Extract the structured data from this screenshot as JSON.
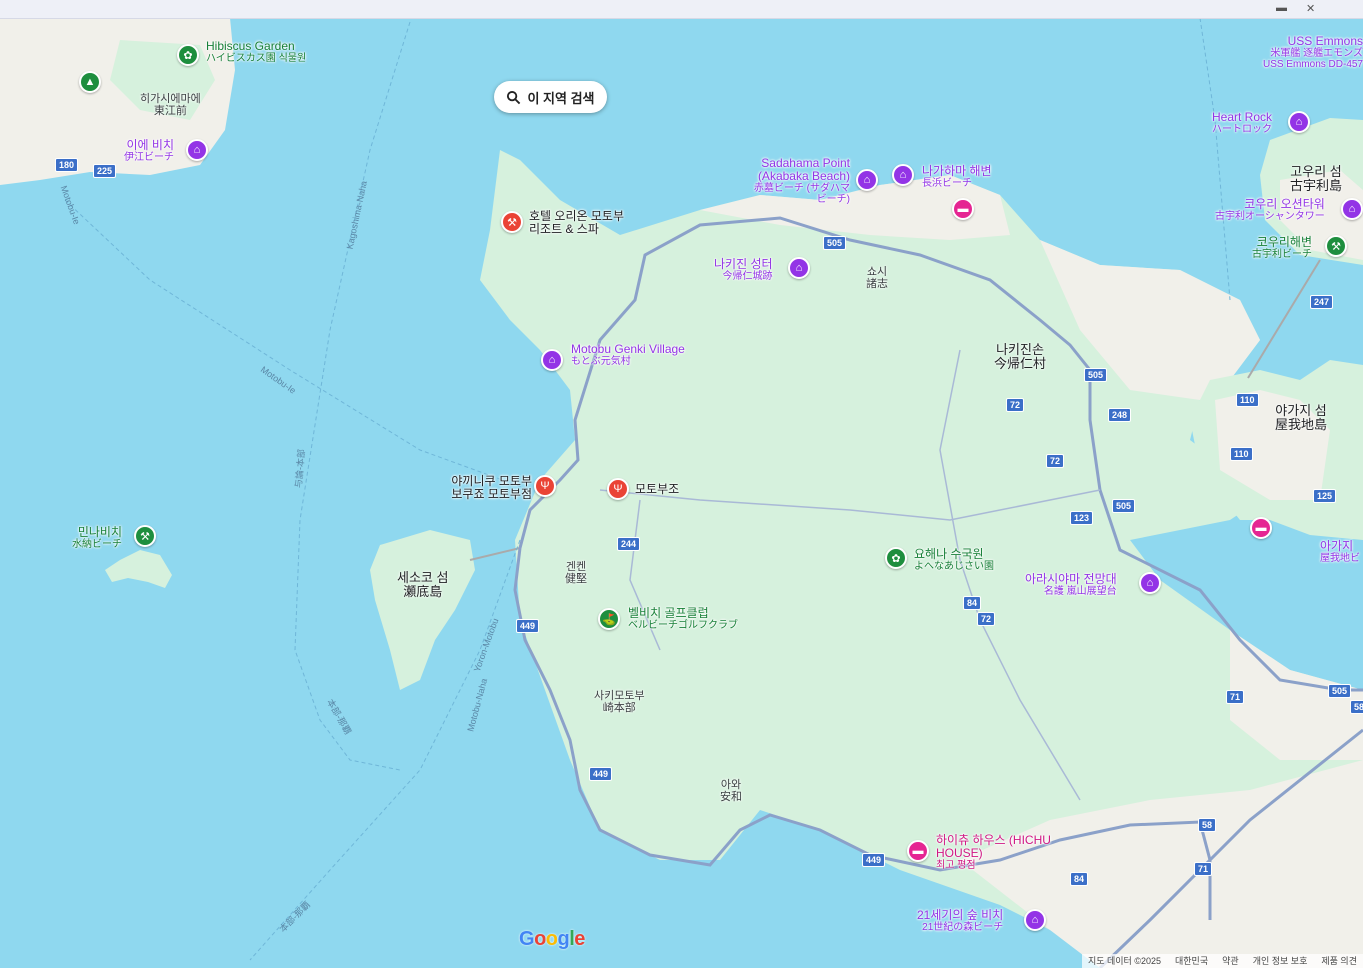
{
  "search_button": {
    "label": "이 지역 검색",
    "icon": "search-icon"
  },
  "places": [
    {
      "name": "Hibiscus Garden",
      "sub": "ハイビスカス園 식물원",
      "type": "garden"
    },
    {
      "name": "이에 비치",
      "sub": "伊江ビーチ",
      "type": "attraction"
    },
    {
      "name": "호텔 오리온 모토부 리조트 & 스파",
      "sub": "",
      "type": "hotel"
    },
    {
      "name": "Sadahama Point (Akabaka Beach)",
      "sub": "赤墓ビーチ (サダハマビーチ)",
      "type": "attraction"
    },
    {
      "name": "나가하마 해변",
      "sub": "長浜ビーチ",
      "type": "attraction"
    },
    {
      "name": "나키진 성터",
      "sub": "今帰仁城跡",
      "type": "attraction"
    },
    {
      "name": "Motobu Genki Village",
      "sub": "もとぶ元気村",
      "type": "attraction"
    },
    {
      "name": "야끼니쿠 모토부 보쿠죠 모토부점",
      "sub": "",
      "type": "restaurant"
    },
    {
      "name": "모토부조",
      "sub": "",
      "type": "restaurant"
    },
    {
      "name": "민나비치",
      "sub": "水納ビーチ",
      "type": "beach"
    },
    {
      "name": "요해나 수국원",
      "sub": "よへなあじさい園",
      "type": "garden"
    },
    {
      "name": "벨비치 골프클럽",
      "sub": "ベルビーチゴルフクラブ",
      "type": "golf"
    },
    {
      "name": "아라시야마 전망대",
      "sub": "名護 嵐山展望台",
      "type": "attraction"
    },
    {
      "name": "USS Emmons",
      "sub": "米軍艦 逐艦エモンズ USS Emmons DD-457",
      "type": "attraction"
    },
    {
      "name": "Heart Rock",
      "sub": "ハートロック",
      "type": "attraction"
    },
    {
      "name": "코우리 오션타워",
      "sub": "古宇利オーシャンタワー",
      "type": "attraction"
    },
    {
      "name": "코우리해변",
      "sub": "古宇利ビーチ",
      "type": "beach"
    },
    {
      "name": "하이츄 하우스 (HICHU HOUSE)",
      "sub": "최고 평점",
      "type": "hotel"
    },
    {
      "name": "21세기의 숲 비치",
      "sub": "21世紀の森ビーチ",
      "type": "attraction"
    },
    {
      "name": "아가지",
      "sub": "屋我地ビ",
      "type": "attraction"
    }
  ],
  "towns": [
    {
      "name": "히가시에마에",
      "sub": "東江前"
    },
    {
      "name": "쇼시",
      "sub": "諸志"
    },
    {
      "name": "나키진손",
      "sub": "今帰仁村"
    },
    {
      "name": "고우리 섬",
      "sub": "古宇利島"
    },
    {
      "name": "야가지 섬",
      "sub": "屋我地島"
    },
    {
      "name": "겐켄",
      "sub": "健堅"
    },
    {
      "name": "세소코 섬",
      "sub": "瀬底島"
    },
    {
      "name": "사키모토부",
      "sub": "崎本部"
    },
    {
      "name": "아와",
      "sub": "安和"
    }
  ],
  "road_shields": [
    "180",
    "225",
    "505",
    "505",
    "505",
    "505",
    "247",
    "248",
    "110",
    "110",
    "125",
    "72",
    "72",
    "72",
    "123",
    "244",
    "449",
    "449",
    "449",
    "84",
    "84",
    "71",
    "71",
    "58",
    "58"
  ],
  "sea_routes": [
    "Kagoshima-Naha",
    "Motobu-Ie",
    "Motobu-Ie",
    "与論-本部",
    "Yoron-Motobu",
    "Motobu-Naha",
    "本部-那覇",
    "本部-那覇"
  ],
  "attribution": [
    "지도 데이터 ©2025",
    "대한민국",
    "약관",
    "개인 정보 보호",
    "제품 의견"
  ],
  "colors": {
    "sea": "#8fd8ef",
    "land": "#d6f1dd",
    "urban": "#f1f0ea",
    "road": "#8ba1c9",
    "poi_purple": "#9334e6",
    "poi_green": "#1e8e3e",
    "poi_red": "#ea4335",
    "poi_pink": "#e52592",
    "shield": "#3b6fc8"
  }
}
